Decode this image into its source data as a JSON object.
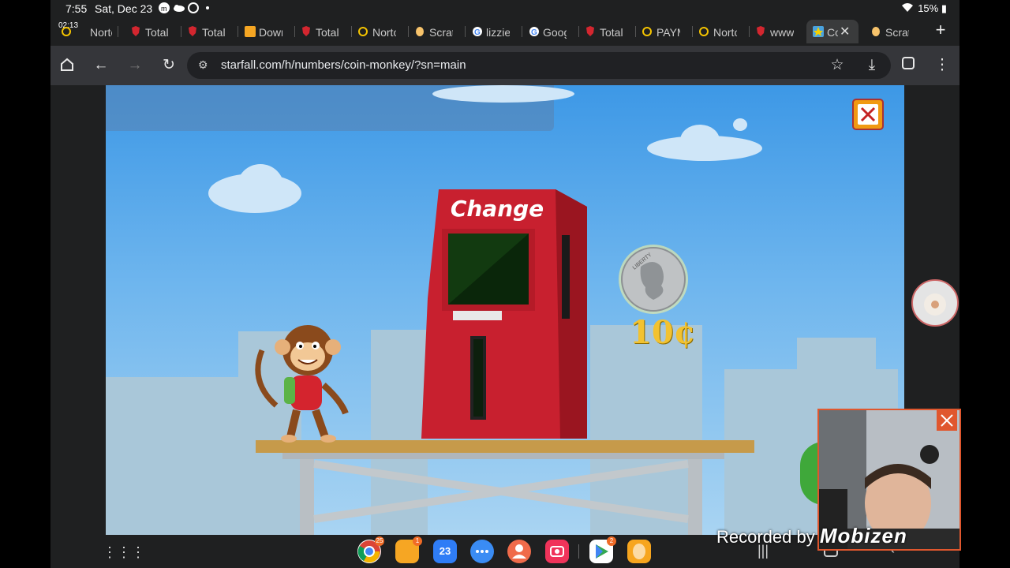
{
  "status_bar": {
    "time": "7:55",
    "date": "Sat, Dec 23",
    "battery": "15%"
  },
  "tabs": [
    {
      "label": "Norto",
      "icon": "norton-icon",
      "timer": "02:13"
    },
    {
      "label": "Total",
      "icon": "shield-icon"
    },
    {
      "label": "Total",
      "icon": "shield-icon"
    },
    {
      "label": "Down",
      "icon": "download-site-icon"
    },
    {
      "label": "Total",
      "icon": "shield-icon"
    },
    {
      "label": "Norto",
      "icon": "norton-icon"
    },
    {
      "label": "Scrat",
      "icon": "scratch-icon"
    },
    {
      "label": "lizzie",
      "icon": "google-icon"
    },
    {
      "label": "Goog",
      "icon": "google-icon"
    },
    {
      "label": "Total",
      "icon": "shield-icon"
    },
    {
      "label": "PAYM",
      "icon": "norton-icon"
    },
    {
      "label": "Norto",
      "icon": "norton-icon"
    },
    {
      "label": "www",
      "icon": "shield-icon"
    },
    {
      "label": "Co",
      "icon": "starfall-icon",
      "active": true
    },
    {
      "label": "Scrat",
      "icon": "scratch-icon"
    }
  ],
  "toolbar": {
    "url": "starfall.com/h/numbers/coin-monkey/?sn=main"
  },
  "game": {
    "machine_label": "Change",
    "coin_value": "10¢",
    "coin_text": "LIBERTY"
  },
  "dock": [
    {
      "app": "chrome",
      "badge": "25"
    },
    {
      "app": "files",
      "badge": "1"
    },
    {
      "app": "calendar",
      "label": "23"
    },
    {
      "app": "messages"
    },
    {
      "app": "contacts"
    },
    {
      "app": "screen-recorder"
    },
    {
      "app": "play-store",
      "badge": "2"
    },
    {
      "app": "scratch"
    }
  ],
  "watermark": {
    "prefix": "Recorded by",
    "brand": "Mobizen"
  },
  "colors": {
    "sky": "#3d98e6",
    "machine_red": "#c8202f",
    "coin_gold": "#f2c230"
  }
}
